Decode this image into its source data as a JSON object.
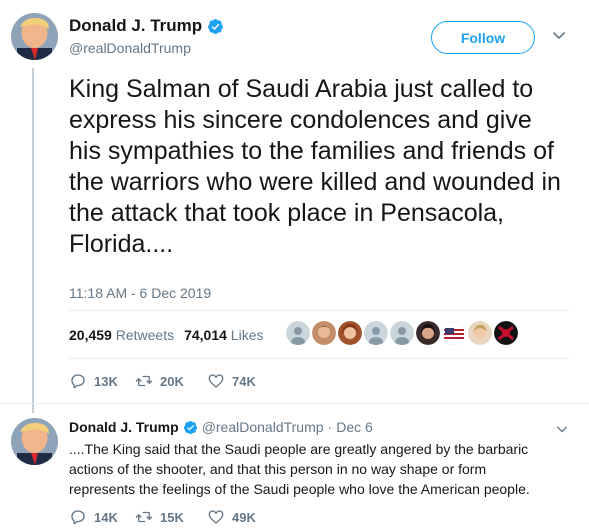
{
  "main_tweet": {
    "author_name": "Donald J. Trump",
    "author_handle": "@realDonaldTrump",
    "follow_label": "Follow",
    "text": "King Salman of Saudi Arabia just called to express his sincere condolences and give his sympathies to the families and friends of the warriors who were killed and wounded in the attack that took place in Pensacola, Florida....",
    "timestamp": "11:18 AM - 6 Dec 2019",
    "retweets_count": "20,459",
    "retweets_label": "Retweets",
    "likes_count": "74,014",
    "likes_label": "Likes",
    "actions": {
      "replies": "13K",
      "retweets": "20K",
      "likes": "74K"
    }
  },
  "reply_tweet": {
    "author_name": "Donald J. Trump",
    "author_handle": "@realDonaldTrump",
    "separator": "·",
    "date": "Dec 6",
    "text": "....The King said that the Saudi people are greatly angered by the barbaric actions of the shooter, and that this person in no way shape or form represents the feelings of the Saudi people who love the American people.",
    "actions": {
      "replies": "14K",
      "retweets": "15K",
      "likes": "49K"
    }
  },
  "icons": {
    "verified": "verified-badge-icon",
    "caret": "chevron-down-icon",
    "reply": "reply-icon",
    "retweet": "retweet-icon",
    "like": "heart-icon"
  },
  "colors": {
    "accent": "#1da1f2",
    "muted": "#657786",
    "text": "#14171a",
    "thread_line": "#c4cfd6"
  }
}
